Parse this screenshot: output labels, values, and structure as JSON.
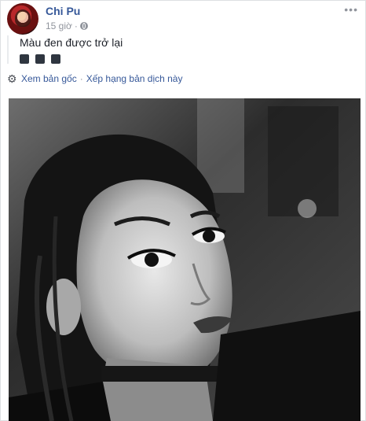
{
  "post": {
    "author": "Chi Pu",
    "time": "15 giờ",
    "text": "Màu đen được trở lại",
    "emoji": [
      "black-square-icon",
      "black-square-icon",
      "black-square-icon"
    ],
    "translate": {
      "see_original": "Xem bản gốc",
      "separator": "·",
      "rate": "Xếp hạng bản dịch này"
    },
    "photo_icon": "portrait-photo"
  },
  "colors": {
    "link": "#365899",
    "meta": "#90949c",
    "text": "#1d2129"
  }
}
